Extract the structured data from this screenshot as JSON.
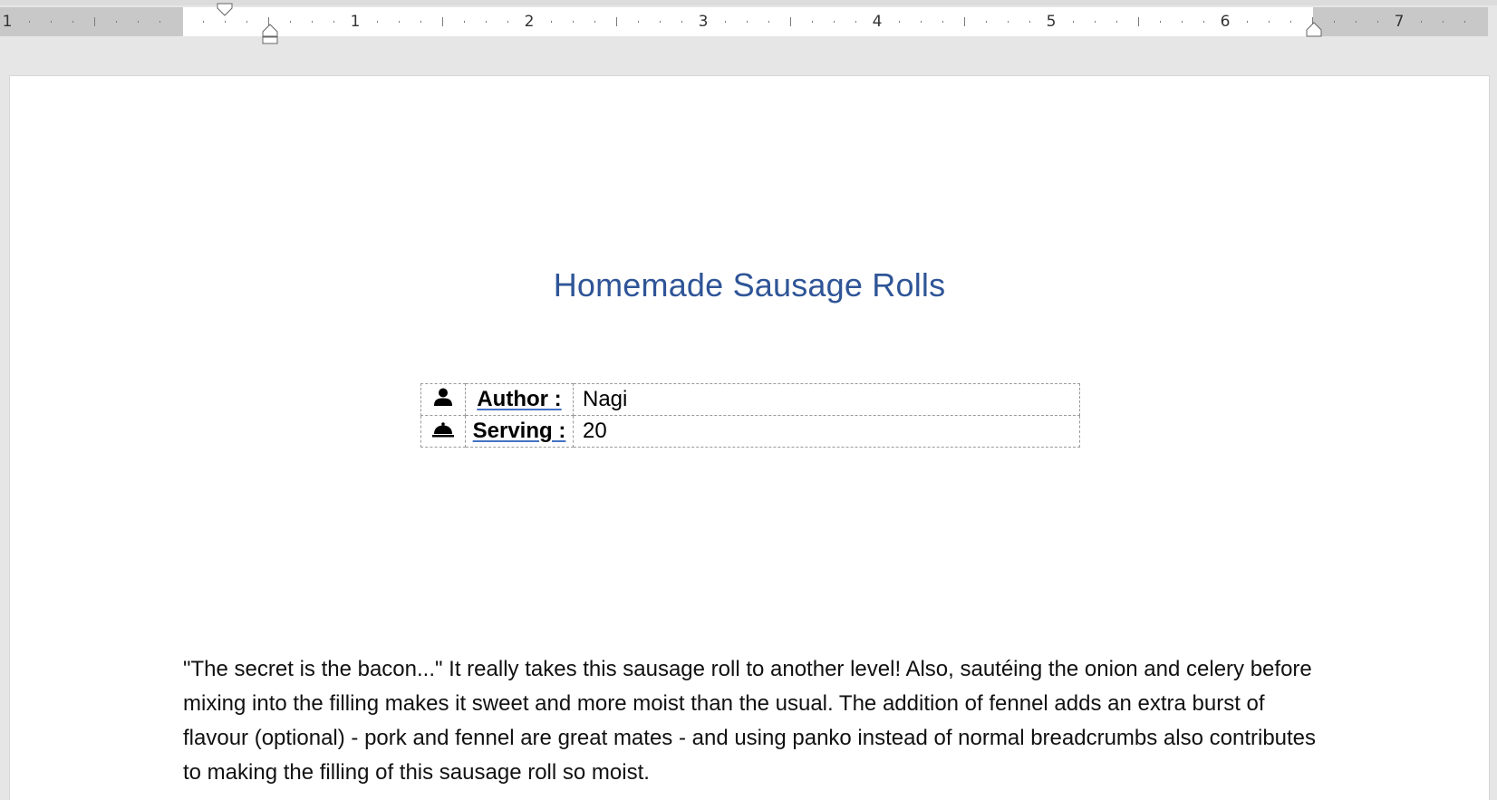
{
  "ruler": {
    "numbers": [
      "1",
      "1",
      "2",
      "3",
      "4",
      "5",
      "6",
      "7"
    ]
  },
  "document": {
    "title": "Homemade Sausage Rolls",
    "meta": [
      {
        "icon": "person-icon",
        "label": "Author :",
        "value": "Nagi"
      },
      {
        "icon": "serving-cloche-icon",
        "label": "Serving :",
        "value": "20"
      }
    ],
    "intro_paragraph": "\"The secret is the bacon...\" It really takes this sausage roll to another level! Also, sautéing the onion and celery before mixing into the filling makes it sweet and more moist than the usual. The addition of fennel adds an extra burst of flavour (optional) - pork and fennel are great mates - and using panko instead of normal breadcrumbs also contributes to making the filling of this sausage roll so moist."
  },
  "colors": {
    "title": "#2f5597",
    "page_background": "#e6e6e6",
    "document_background": "#ffffff"
  }
}
